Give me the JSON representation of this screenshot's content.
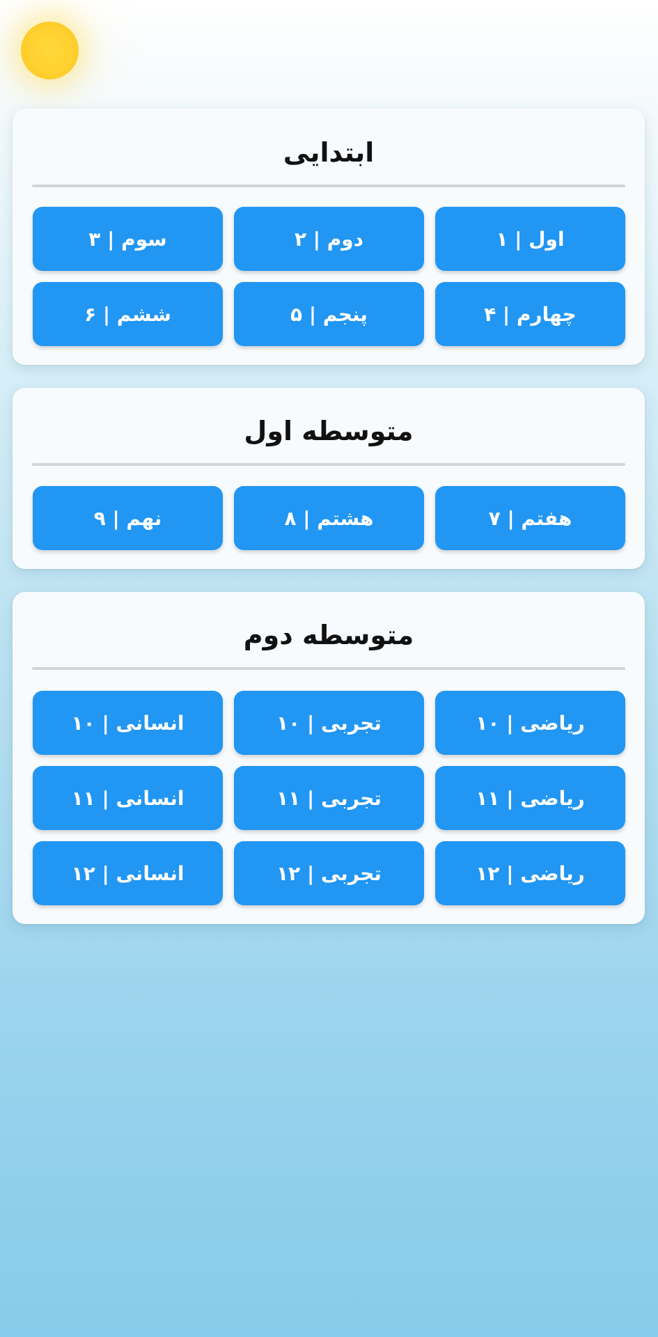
{
  "colors": {
    "button": "#2196f3",
    "sun": "#ffd83a",
    "card_bg": "#f8fbfd"
  },
  "decor": {
    "sun_icon": "sun-icon"
  },
  "sections": {
    "primary": {
      "title": "ابتدایی",
      "buttons": [
        "اول | ۱",
        "دوم | ۲",
        "سوم | ۳",
        "چهارم | ۴",
        "پنجم | ۵",
        "ششم | ۶"
      ]
    },
    "middle1": {
      "title": "متوسطه اول",
      "buttons": [
        "هفتم | ۷",
        "هشتم | ۸",
        "نهم | ۹"
      ]
    },
    "middle2": {
      "title": "متوسطه دوم",
      "buttons": [
        "ریاضی | ۱۰",
        "تجربی | ۱۰",
        "انسانی | ۱۰",
        "ریاضی | ۱۱",
        "تجربی | ۱۱",
        "انسانی | ۱۱",
        "ریاضی | ۱۲",
        "تجربی | ۱۲",
        "انسانی | ۱۲"
      ]
    }
  }
}
